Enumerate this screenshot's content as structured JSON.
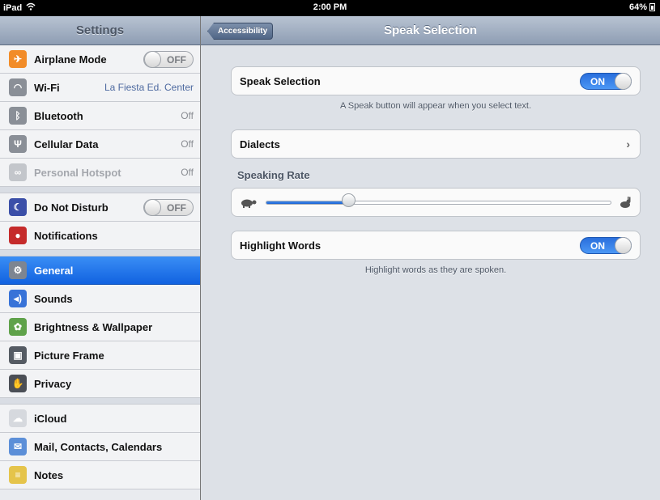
{
  "status_bar": {
    "device": "iPad",
    "time": "2:00 PM",
    "battery": "64%"
  },
  "sidebar": {
    "title": "Settings",
    "items": [
      {
        "label": "Airplane Mode",
        "icon": "airplane-icon",
        "color": "#f28c28",
        "toggle": "OFF",
        "value": null
      },
      {
        "label": "Wi-Fi",
        "icon": "wifi-icon",
        "color": "#8a8f97",
        "toggle": null,
        "value": "La Fiesta Ed. Center"
      },
      {
        "label": "Bluetooth",
        "icon": "bluetooth-icon",
        "color": "#8a8f97",
        "toggle": null,
        "value": "Off"
      },
      {
        "label": "Cellular Data",
        "icon": "antenna-icon",
        "color": "#8a8f97",
        "toggle": null,
        "value": "Off"
      },
      {
        "label": "Personal Hotspot",
        "icon": "hotspot-icon",
        "color": "#c3c6cb",
        "toggle": null,
        "value": "Off",
        "dim": true
      },
      {
        "label": "Do Not Disturb",
        "icon": "moon-icon",
        "color": "#3b4fa8",
        "toggle": "OFF",
        "value": null,
        "group_start": true
      },
      {
        "label": "Notifications",
        "icon": "notifications-icon",
        "color": "#c52b2b",
        "toggle": null,
        "value": null
      },
      {
        "label": "General",
        "icon": "gear-icon",
        "color": "#7d8591",
        "toggle": null,
        "value": null,
        "selected": true,
        "group_start": true
      },
      {
        "label": "Sounds",
        "icon": "speaker-icon",
        "color": "#3873d8",
        "toggle": null,
        "value": null
      },
      {
        "label": "Brightness & Wallpaper",
        "icon": "flower-icon",
        "color": "#5fa24a",
        "toggle": null,
        "value": null
      },
      {
        "label": "Picture Frame",
        "icon": "picture-frame-icon",
        "color": "#555b63",
        "toggle": null,
        "value": null
      },
      {
        "label": "Privacy",
        "icon": "hand-icon",
        "color": "#4b4f56",
        "toggle": null,
        "value": null
      },
      {
        "label": "iCloud",
        "icon": "cloud-icon",
        "color": "#d6d9de",
        "toggle": null,
        "value": null,
        "group_start": true
      },
      {
        "label": "Mail, Contacts, Calendars",
        "icon": "mail-icon",
        "color": "#5c8fd8",
        "toggle": null,
        "value": null
      },
      {
        "label": "Notes",
        "icon": "notes-icon",
        "color": "#e5c44b",
        "toggle": null,
        "value": null
      }
    ]
  },
  "detail": {
    "back_label": "Accessibility",
    "title": "Speak Selection",
    "speak_selection": {
      "label": "Speak Selection",
      "state": "ON",
      "footer": "A Speak button will appear when you select text."
    },
    "dialects": {
      "label": "Dialects"
    },
    "speaking_rate": {
      "header": "Speaking Rate",
      "value": 0.24,
      "slow_icon": "turtle-icon",
      "fast_icon": "rabbit-icon"
    },
    "highlight_words": {
      "label": "Highlight Words",
      "state": "ON",
      "footer": "Highlight words as they are spoken."
    }
  },
  "colors": {
    "accent": "#1162e0",
    "switch_on": "#2a6fdc"
  }
}
